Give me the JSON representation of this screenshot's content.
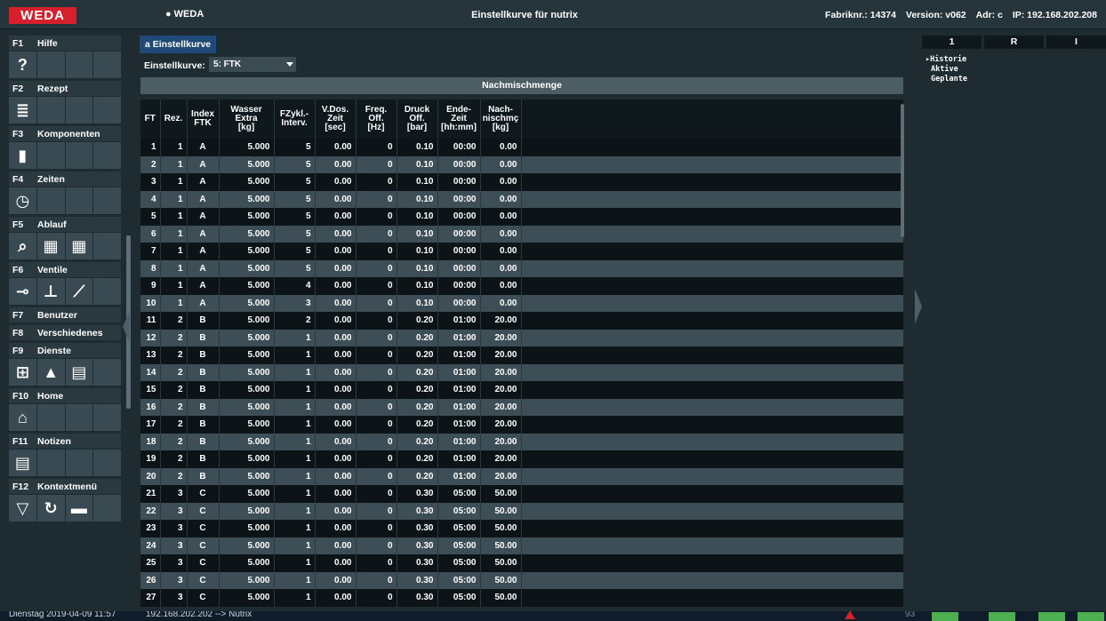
{
  "header": {
    "logo": "WEDA",
    "user": "WEDA",
    "title": "Einstellkurve für nutrix",
    "fabriknr": "Fabriknr.: 14374",
    "version": "Version: v062",
    "adr": "Adr: c",
    "ip": "IP: 192.168.202.208"
  },
  "sidebar": {
    "groups": [
      {
        "key": "F1",
        "label": "Hilfe",
        "tiles": [
          "?",
          "",
          "",
          ""
        ]
      },
      {
        "key": "F2",
        "label": "Rezept",
        "tiles": [
          "≣",
          "",
          "",
          ""
        ]
      },
      {
        "key": "F3",
        "label": "Komponenten",
        "tiles": [
          "▮",
          "",
          "",
          ""
        ]
      },
      {
        "key": "F4",
        "label": "Zeiten",
        "tiles": [
          "◷",
          "",
          "",
          ""
        ]
      },
      {
        "key": "F5",
        "label": "Ablauf",
        "tiles": [
          "⌕",
          "▦",
          "▦",
          ""
        ]
      },
      {
        "key": "F6",
        "label": "Ventile",
        "tiles": [
          "⊸",
          "⊥",
          "⟋",
          ""
        ]
      },
      {
        "key": "F7",
        "label": "Benutzer"
      },
      {
        "key": "F8",
        "label": "Verschiedenes"
      },
      {
        "key": "F9",
        "label": "Dienste",
        "tiles": [
          "⊞",
          "▲",
          "▤",
          ""
        ]
      },
      {
        "key": "F10",
        "label": "Home",
        "tiles": [
          "⌂",
          "",
          "",
          ""
        ]
      },
      {
        "key": "F11",
        "label": "Notizen",
        "tiles": [
          "▤",
          "",
          "",
          ""
        ]
      },
      {
        "key": "F12",
        "label": "Kontextmenü",
        "tiles": [
          "▽",
          "↻",
          "▬",
          ""
        ]
      }
    ]
  },
  "main": {
    "tab_label": "a Einstellkurve",
    "kurve_label": "Einstellkurve:",
    "kurve_value": "5: FTK",
    "section_header": "Nachmischmenge",
    "columns": [
      "FT",
      "Rez.",
      "Index\nFTK",
      "Wasser\nExtra\n[kg]",
      "FZykl.-\nInterv.",
      "V.Dos.\nZeit\n[sec]",
      "Freq.\nOff.\n[Hz]",
      "Druck\nOff.\n[bar]",
      "Ende-\nZeit\n[hh:mm]",
      "Nach-\nnischmç\n[kg]"
    ],
    "rows": [
      [
        "1",
        "1",
        "A",
        "5.000",
        "5",
        "0.00",
        "0",
        "0.10",
        "00:00",
        "0.00"
      ],
      [
        "2",
        "1",
        "A",
        "5.000",
        "5",
        "0.00",
        "0",
        "0.10",
        "00:00",
        "0.00"
      ],
      [
        "3",
        "1",
        "A",
        "5.000",
        "5",
        "0.00",
        "0",
        "0.10",
        "00:00",
        "0.00"
      ],
      [
        "4",
        "1",
        "A",
        "5.000",
        "5",
        "0.00",
        "0",
        "0.10",
        "00:00",
        "0.00"
      ],
      [
        "5",
        "1",
        "A",
        "5.000",
        "5",
        "0.00",
        "0",
        "0.10",
        "00:00",
        "0.00"
      ],
      [
        "6",
        "1",
        "A",
        "5.000",
        "5",
        "0.00",
        "0",
        "0.10",
        "00:00",
        "0.00"
      ],
      [
        "7",
        "1",
        "A",
        "5.000",
        "5",
        "0.00",
        "0",
        "0.10",
        "00:00",
        "0.00"
      ],
      [
        "8",
        "1",
        "A",
        "5.000",
        "5",
        "0.00",
        "0",
        "0.10",
        "00:00",
        "0.00"
      ],
      [
        "9",
        "1",
        "A",
        "5.000",
        "4",
        "0.00",
        "0",
        "0.10",
        "00:00",
        "0.00"
      ],
      [
        "10",
        "1",
        "A",
        "5.000",
        "3",
        "0.00",
        "0",
        "0.10",
        "00:00",
        "0.00"
      ],
      [
        "11",
        "2",
        "B",
        "5.000",
        "2",
        "0.00",
        "0",
        "0.20",
        "01:00",
        "20.00"
      ],
      [
        "12",
        "2",
        "B",
        "5.000",
        "1",
        "0.00",
        "0",
        "0.20",
        "01:00",
        "20.00"
      ],
      [
        "13",
        "2",
        "B",
        "5.000",
        "1",
        "0.00",
        "0",
        "0.20",
        "01:00",
        "20.00"
      ],
      [
        "14",
        "2",
        "B",
        "5.000",
        "1",
        "0.00",
        "0",
        "0.20",
        "01:00",
        "20.00"
      ],
      [
        "15",
        "2",
        "B",
        "5.000",
        "1",
        "0.00",
        "0",
        "0.20",
        "01:00",
        "20.00"
      ],
      [
        "16",
        "2",
        "B",
        "5.000",
        "1",
        "0.00",
        "0",
        "0.20",
        "01:00",
        "20.00"
      ],
      [
        "17",
        "2",
        "B",
        "5.000",
        "1",
        "0.00",
        "0",
        "0.20",
        "01:00",
        "20.00"
      ],
      [
        "18",
        "2",
        "B",
        "5.000",
        "1",
        "0.00",
        "0",
        "0.20",
        "01:00",
        "20.00"
      ],
      [
        "19",
        "2",
        "B",
        "5.000",
        "1",
        "0.00",
        "0",
        "0.20",
        "01:00",
        "20.00"
      ],
      [
        "20",
        "2",
        "B",
        "5.000",
        "1",
        "0.00",
        "0",
        "0.20",
        "01:00",
        "20.00"
      ],
      [
        "21",
        "3",
        "C",
        "5.000",
        "1",
        "0.00",
        "0",
        "0.30",
        "05:00",
        "50.00"
      ],
      [
        "22",
        "3",
        "C",
        "5.000",
        "1",
        "0.00",
        "0",
        "0.30",
        "05:00",
        "50.00"
      ],
      [
        "23",
        "3",
        "C",
        "5.000",
        "1",
        "0.00",
        "0",
        "0.30",
        "05:00",
        "50.00"
      ],
      [
        "24",
        "3",
        "C",
        "5.000",
        "1",
        "0.00",
        "0",
        "0.30",
        "05:00",
        "50.00"
      ],
      [
        "25",
        "3",
        "C",
        "5.000",
        "1",
        "0.00",
        "0",
        "0.30",
        "05:00",
        "50.00"
      ],
      [
        "26",
        "3",
        "C",
        "5.000",
        "1",
        "0.00",
        "0",
        "0.30",
        "05:00",
        "50.00"
      ],
      [
        "27",
        "3",
        "C",
        "5.000",
        "1",
        "0.00",
        "0",
        "0.30",
        "05:00",
        "50.00"
      ]
    ]
  },
  "right": {
    "tabs": [
      "1",
      "R",
      "I"
    ],
    "list": [
      "Historie",
      "Aktive",
      "Geplante"
    ]
  },
  "footer": {
    "datetime": "Dienstag 2019-04-09 11:57",
    "connection": "192.168.202.202 --> Nutrix",
    "number": "93"
  },
  "colors": {
    "logo_red": "#d4212b",
    "tab_blue": "#1f4a77",
    "status_green": "#4caf50"
  }
}
